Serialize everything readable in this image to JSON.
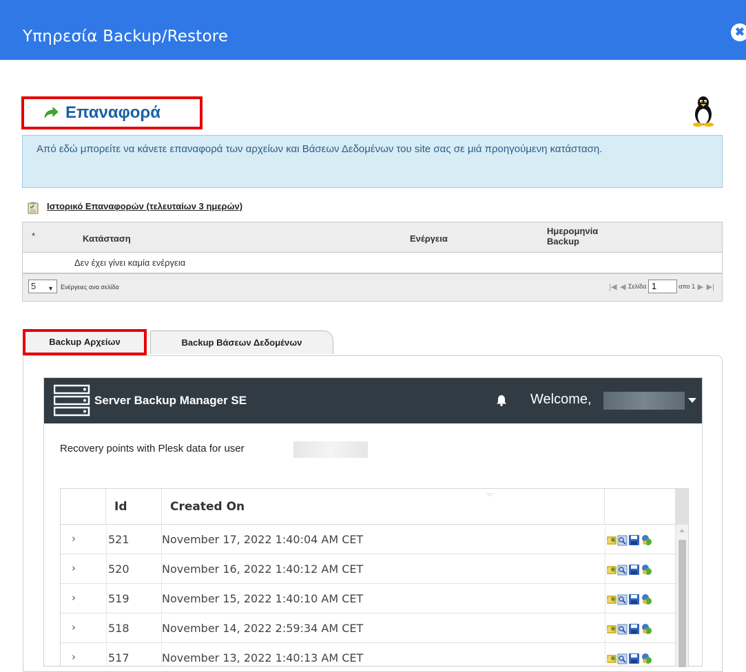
{
  "modal": {
    "title": "Υπηρεσία Backup/Restore",
    "close_glyph": "✖"
  },
  "heading": {
    "title": "Επαναφορά",
    "icon": "green-arrow-icon"
  },
  "info": {
    "text": "Από εδώ μπορείτε να κάνετε επαναφορά των αρχείων και Βάσεων Δεδομένων του site σας σε μιά προηγούμενη κατάσταση."
  },
  "history": {
    "title": "Ιστορικό Επαναφορών (τελευταίων 3 ημερών)",
    "columns": {
      "star": "*",
      "state": "Κατάσταση",
      "action": "Ενέργεια",
      "date_line1": "Ημερομηνία",
      "date_line2": "Backup"
    },
    "empty_message": "Δεν έχει γίνει καμία ενέργεια",
    "pager": {
      "per_page_value": "5",
      "per_page_label": "Ενέργειες ανα σελίδα",
      "page_label": "Σελίδα",
      "page_value": "1",
      "of_label": "απο 1"
    }
  },
  "tabs": [
    {
      "label": "Backup Αρχείων",
      "active": true
    },
    {
      "label": "Backup Βάσεων Δεδομένων",
      "active": false
    }
  ],
  "app": {
    "name": "Server Backup Manager SE",
    "welcome": "Welcome,",
    "recovery_text": "Recovery points with Plesk data for user",
    "grid": {
      "columns": {
        "id": "Id",
        "created_on": "Created On"
      },
      "rows": [
        {
          "expand": "›",
          "id": "521",
          "created_on": "November 17, 2022 1:40:04 AM CET"
        },
        {
          "expand": "›",
          "id": "520",
          "created_on": "November 16, 2022 1:40:12 AM CET"
        },
        {
          "expand": "›",
          "id": "519",
          "created_on": "November 15, 2022 1:40:10 AM CET"
        },
        {
          "expand": "›",
          "id": "518",
          "created_on": "November 14, 2022 2:59:34 AM CET"
        },
        {
          "expand": "›",
          "id": "517",
          "created_on": "November 13, 2022 1:40:13 AM CET"
        }
      ]
    }
  },
  "colors": {
    "header_blue": "#2f78e6",
    "highlight_red": "#e60000",
    "heading_blue": "#1c5fa5",
    "info_bg": "#d8ecf6",
    "app_nav": "#303b44"
  }
}
